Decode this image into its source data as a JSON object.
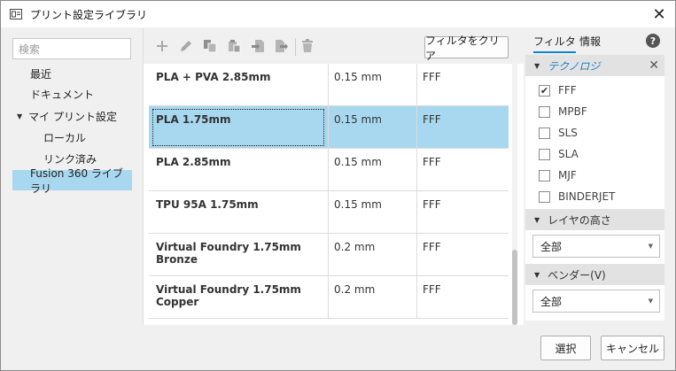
{
  "window": {
    "title": "プリント設定ライブラリ",
    "close_glyph": "✕"
  },
  "left_nav": {
    "search_placeholder": "検索",
    "items": [
      {
        "label": "最近",
        "level": 0
      },
      {
        "label": "ドキュメント",
        "level": 0
      },
      {
        "label": "マイ プリント設定",
        "level": 0,
        "expanded": true
      },
      {
        "label": "ローカル",
        "level": 1
      },
      {
        "label": "リンク済み",
        "level": 1
      },
      {
        "label": "Fusion 360 ライブラリ",
        "level": 0,
        "selected": true
      }
    ]
  },
  "toolbar": {
    "icons": [
      "add-icon",
      "edit-icon",
      "copy-icon",
      "paste-icon",
      "import-icon",
      "export-icon",
      "delete-icon"
    ],
    "clear_filter_label": "フィルタをクリア"
  },
  "table": {
    "rows": [
      {
        "name": "PLA + PVA 2.85mm",
        "layer": "0.15 mm",
        "tech": "FFF",
        "selected": false
      },
      {
        "name": "PLA 1.75mm",
        "layer": "0.15 mm",
        "tech": "FFF",
        "selected": true
      },
      {
        "name": "PLA 2.85mm",
        "layer": "0.15 mm",
        "tech": "FFF",
        "selected": false
      },
      {
        "name": "TPU 95A 1.75mm",
        "layer": "0.15 mm",
        "tech": "FFF",
        "selected": false
      },
      {
        "name": "Virtual Foundry 1.75mm Bronze",
        "layer": "0.2 mm",
        "tech": "FFF",
        "selected": false
      },
      {
        "name": "Virtual Foundry 1.75mm Copper",
        "layer": "0.2 mm",
        "tech": "FFF",
        "selected": false
      }
    ]
  },
  "filter_panel": {
    "tabs": [
      "フィルタ",
      "情報"
    ],
    "active_tab": "フィルタ",
    "help_glyph": "?",
    "technology": {
      "label": "テクノロジ",
      "options": [
        {
          "label": "FFF",
          "checked": true
        },
        {
          "label": "MPBF",
          "checked": false
        },
        {
          "label": "SLS",
          "checked": false
        },
        {
          "label": "SLA",
          "checked": false
        },
        {
          "label": "MJF",
          "checked": false
        },
        {
          "label": "BINDERJET",
          "checked": false
        }
      ]
    },
    "layer_height": {
      "label": "レイヤの高さ",
      "value": "全部"
    },
    "vendor": {
      "label": "ベンダー(V)",
      "value": "全部"
    }
  },
  "buttons": {
    "select": "選択",
    "cancel": "キャンセル"
  },
  "colors": {
    "selection": "#a8d8ef",
    "accent": "#1b7fc4"
  }
}
